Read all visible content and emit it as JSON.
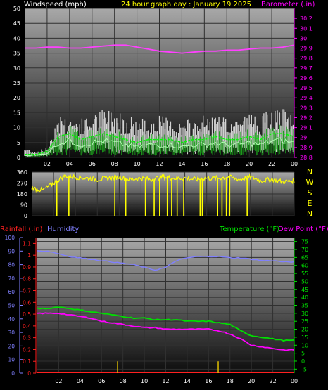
{
  "title": "24 hour graph day : January 19 2025",
  "colors": {
    "background": "#000000",
    "white_label": "#ffffff",
    "yellow": "#ffff00",
    "magenta": "#ff00ff",
    "red": "#ff2020",
    "humidity_blue": "#8080ff",
    "green": "#00e000",
    "pink": "#ff00ff",
    "axis_tick_text": "#ffffff"
  },
  "chart_data": [
    {
      "id": "wind_baro",
      "type": "line",
      "title_left": "Windspeed (mph)",
      "title_right": "Barometer (.in)",
      "x_ticks": [
        "02",
        "04",
        "06",
        "08",
        "10",
        "12",
        "14",
        "16",
        "18",
        "20",
        "22",
        "00"
      ],
      "y_left": {
        "min": 0,
        "max": 50,
        "ticks": [
          0,
          5,
          10,
          15,
          20,
          25,
          30,
          35,
          40,
          45,
          50
        ]
      },
      "y_right": {
        "min": 28.8,
        "max": 30.3,
        "ticks": [
          28.8,
          28.9,
          29.0,
          29.1,
          29.2,
          29.3,
          29.4,
          29.5,
          29.6,
          29.7,
          29.8,
          29.9,
          30.0,
          30.1,
          30.2
        ],
        "tick_labels": [
          "28.8",
          "28.9",
          "29",
          "29.1",
          "29.2",
          "29.3",
          "29.4",
          "29.5",
          "29.6",
          "29.7",
          "29.8",
          "29.9",
          "30",
          "30.1",
          "30.2"
        ]
      },
      "hours": [
        0,
        1,
        2,
        3,
        4,
        5,
        6,
        7,
        8,
        9,
        10,
        11,
        12,
        13,
        14,
        15,
        16,
        17,
        18,
        19,
        20,
        21,
        22,
        23,
        24
      ],
      "series": [
        {
          "name": "Barometer",
          "axis": "right",
          "color": "#ff40ff",
          "values": [
            29.9,
            29.9,
            29.91,
            29.91,
            29.9,
            29.9,
            29.91,
            29.92,
            29.93,
            29.93,
            29.91,
            29.89,
            29.87,
            29.86,
            29.85,
            29.86,
            29.87,
            29.87,
            29.88,
            29.88,
            29.89,
            29.9,
            29.9,
            29.91,
            29.93
          ]
        },
        {
          "name": "Gust",
          "axis": "left",
          "color": "#ffffff",
          "values": [
            3,
            2,
            3,
            14,
            13,
            12,
            13,
            15,
            15,
            14,
            12,
            12,
            13,
            12,
            11,
            12,
            13,
            13,
            12,
            13,
            14,
            13,
            15,
            15,
            13
          ]
        },
        {
          "name": "Average",
          "axis": "left",
          "color": "#00e000",
          "values": [
            1,
            1,
            2,
            7,
            8,
            6,
            7,
            8,
            7,
            6,
            5,
            6,
            6,
            6,
            5,
            6,
            6,
            7,
            6,
            6,
            7,
            6,
            8,
            8,
            7
          ]
        }
      ]
    },
    {
      "id": "wind_dir",
      "type": "line",
      "y_ticks": [
        0,
        90,
        180,
        270,
        360
      ],
      "compass_labels": [
        "N",
        "W",
        "S",
        "E",
        "N"
      ],
      "hours": [
        0,
        1,
        2,
        3,
        4,
        5,
        6,
        7,
        8,
        9,
        10,
        11,
        12,
        13,
        14,
        15,
        16,
        17,
        18,
        19,
        20,
        21,
        22,
        23,
        24
      ],
      "series": [
        {
          "name": "Direction",
          "color": "#ffff00",
          "values": [
            230,
            210,
            270,
            330,
            320,
            310,
            300,
            310,
            320,
            300,
            310,
            300,
            320,
            310,
            310,
            300,
            310,
            310,
            320,
            300,
            320,
            290,
            300,
            280,
            290
          ]
        }
      ],
      "drop_hours": [
        2.3,
        3.4,
        7.6,
        8.6,
        10.4,
        11.2,
        11.7,
        12.4,
        12.8,
        13.3,
        13.9,
        15.4,
        15.6,
        17.0,
        17.4,
        17.8,
        18.1,
        19.7
      ]
    },
    {
      "id": "temp_hum_rain",
      "type": "line",
      "title_left_1": "Rainfall (.in)",
      "title_left_2": "Humidity",
      "title_right_1": "Temperature (°F)",
      "title_right_2": "Dew Point (°F)",
      "x_ticks": [
        "02",
        "04",
        "06",
        "08",
        "10",
        "12",
        "14",
        "16",
        "18",
        "20",
        "22",
        "00"
      ],
      "y_humidity": {
        "min": 0,
        "max": 100,
        "ticks": [
          0,
          10,
          20,
          30,
          40,
          50,
          60,
          70,
          80,
          90,
          100
        ]
      },
      "y_rain": {
        "min": 0,
        "max": 1.15,
        "ticks": [
          0,
          0.1,
          0.2,
          0.3,
          0.4,
          0.5,
          0.6,
          0.7,
          0.8,
          0.9,
          1.0,
          1.1
        ],
        "tick_labels": [
          "0",
          "0.1",
          "0.2",
          "0.3",
          "0.4",
          "0.5",
          "0.6",
          "0.7",
          "0.8",
          "0.9",
          "1",
          "1.1"
        ]
      },
      "y_temp": {
        "min": -7.5,
        "max": 77.5,
        "ticks": [
          -5,
          0,
          5,
          10,
          15,
          20,
          25,
          30,
          35,
          40,
          45,
          50,
          55,
          60,
          65,
          70,
          75
        ]
      },
      "hours": [
        0,
        1,
        2,
        3,
        4,
        5,
        6,
        7,
        8,
        9,
        10,
        11,
        12,
        13,
        14,
        15,
        16,
        17,
        18,
        19,
        20,
        21,
        22,
        23,
        24
      ],
      "series": [
        {
          "name": "Humidity",
          "axis": "humidity",
          "color": "#8080ff",
          "values": [
            90,
            90,
            88,
            86,
            85,
            84,
            83,
            82,
            81,
            80,
            78,
            76,
            78,
            83,
            85,
            86,
            86,
            86,
            85,
            85,
            84,
            83,
            83,
            82,
            82
          ]
        },
        {
          "name": "Temperature",
          "axis": "temp",
          "color": "#00e000",
          "values": [
            33,
            33,
            34,
            33,
            32,
            31,
            30,
            29,
            28,
            27,
            27,
            26,
            26,
            26,
            25,
            25,
            25,
            24,
            23,
            19,
            16,
            15,
            14,
            13,
            13
          ]
        },
        {
          "name": "Dew Point",
          "axis": "temp",
          "color": "#ff00ff",
          "values": [
            30,
            30,
            30,
            29,
            28,
            27,
            25,
            24,
            23,
            22,
            21,
            21,
            20,
            20,
            20,
            20,
            20,
            19,
            17,
            14,
            10,
            9,
            8,
            7,
            7
          ]
        },
        {
          "name": "Rainfall",
          "axis": "rain",
          "color": "#ff2020",
          "values": [
            0,
            0,
            0,
            0,
            0,
            0,
            0,
            0,
            0,
            0,
            0,
            0,
            0,
            0,
            0,
            0,
            0,
            0,
            0,
            0,
            0,
            0,
            0,
            0,
            0
          ]
        }
      ],
      "rain_ticks_hours": [
        7.5,
        16.9
      ]
    }
  ]
}
